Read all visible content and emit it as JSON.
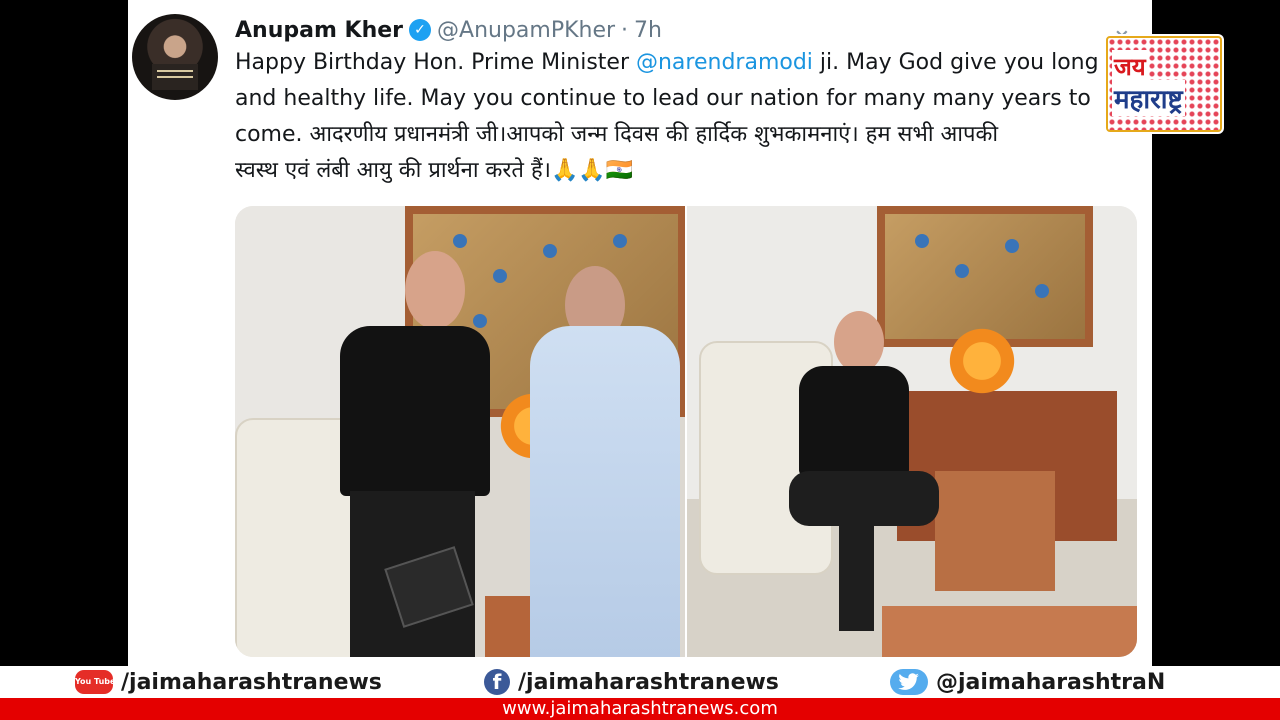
{
  "tweet": {
    "author_name": "Anupam Kher",
    "verified_icon": "verified-badge-icon",
    "handle": "@AnupamPKher",
    "separator": "·",
    "time": "7h",
    "caret_icon": "chevron-down-icon",
    "text_line1_before": "Happy Birthday Hon. Prime Minister ",
    "mention": "@narendramodi",
    "text_line1_after": " ji. May God give you long",
    "text_line2": "and healthy life. May you continue to lead our nation for many many years to",
    "text_line3": "come. आदरणीय प्रधानमंत्री जी।आपको जन्म दिवस की हार्दिक शुभकामनाएं। हम सभी आपकी",
    "text_line4": "स्वस्थ एवं लंबी आयु की प्रार्थना करते हैं।🙏🙏🇮🇳"
  },
  "logo": {
    "line1": "जय",
    "line2": "महाराष्ट्र"
  },
  "footer": {
    "youtube_icon_label": "You Tube",
    "youtube": "/jaimaharashtranews",
    "facebook_icon_label": "f",
    "facebook": "/jaimaharashtranews",
    "twitter": "@jaimaharashtraN",
    "website": "www.jaimaharashtranews.com"
  },
  "colors": {
    "mention": "#1b95e0",
    "url_bar": "#e40000",
    "verified": "#1da1f2"
  }
}
